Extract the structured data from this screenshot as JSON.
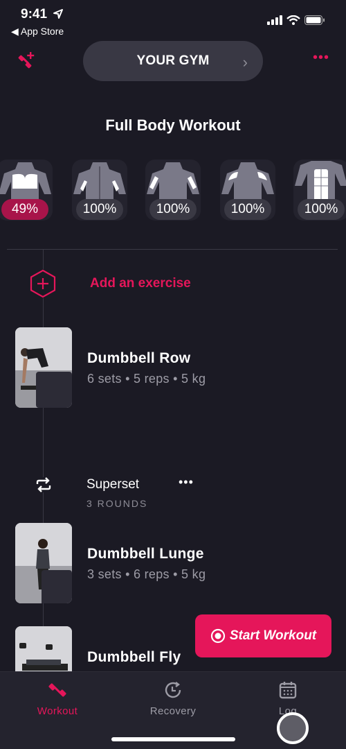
{
  "status_bar": {
    "time": "9:41",
    "back_label": "◀ App Store"
  },
  "header": {
    "gym_label": "YOUR GYM",
    "more_label": "•••"
  },
  "workout": {
    "title": "Full Body Workout",
    "muscles": [
      {
        "name": "chest",
        "recovery": "49%"
      },
      {
        "name": "triceps",
        "recovery": "100%"
      },
      {
        "name": "biceps",
        "recovery": "100%"
      },
      {
        "name": "shoulders",
        "recovery": "100%"
      },
      {
        "name": "abs",
        "recovery": "100%"
      }
    ],
    "add_exercise_label": "Add an exercise",
    "exercises": [
      {
        "name": "Dumbbell Row",
        "meta": "6 sets • 5 reps • 5 kg"
      },
      {
        "name": "Dumbbell Lunge",
        "meta": "3 sets • 6 reps • 5 kg"
      },
      {
        "name": "Dumbbell Fly",
        "meta": ""
      }
    ],
    "superset": {
      "label": "Superset",
      "rounds": "3 ROUNDS",
      "more_label": "•••"
    }
  },
  "start_button": {
    "label": "Start Workout"
  },
  "tabs": [
    {
      "label": "Workout",
      "active": true
    },
    {
      "label": "Recovery",
      "active": false
    },
    {
      "label": "Log",
      "active": false
    }
  ],
  "colors": {
    "accent": "#e5165a",
    "background": "#1b1a24",
    "low_recovery": "#a8144a"
  }
}
